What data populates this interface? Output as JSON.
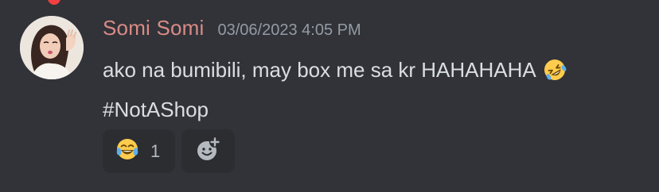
{
  "message": {
    "author": "Somi Somi",
    "timestamp": "03/06/2023 4:05 PM",
    "lines": [
      "ako na bumibili, may box me sa kr HAHAHAHA",
      "#NotAShop"
    ],
    "inline_emoji": "rolling-on-floor-laughing"
  },
  "reactions": [
    {
      "emoji": "face-with-tears-of-joy",
      "count": "1"
    }
  ],
  "add_reaction": {
    "icon": "add-reaction-icon"
  },
  "colors": {
    "background": "#313338",
    "author": "#d98b87",
    "text": "#dbdee1",
    "muted": "#949ba4",
    "reaction_bg": "#2b2d31"
  }
}
